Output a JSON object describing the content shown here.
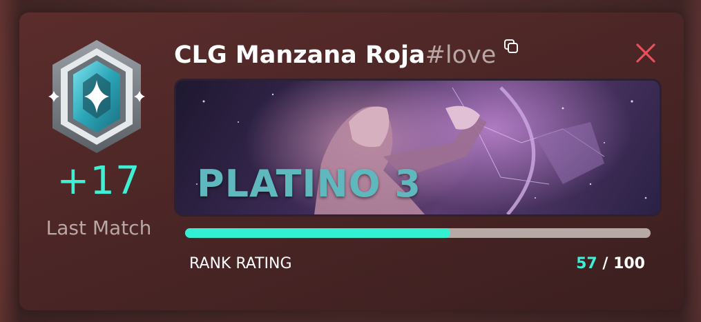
{
  "player": {
    "name": "CLG Manzana Roja",
    "tag": "#love"
  },
  "match": {
    "rr_change": "+17",
    "label": "Last Match"
  },
  "rank": {
    "name": "PLATINO 3"
  },
  "rank_rating": {
    "label": "RANK RATING",
    "current": "57",
    "separator": " / ",
    "max": "100",
    "progress_fraction": 0.57
  },
  "icons": {
    "copy": "copy-icon",
    "close": "close-icon",
    "rank_emblem": "platinum-emblem-icon"
  },
  "colors": {
    "accent": "#3ff0d4",
    "close": "#e8505a",
    "rank_text": "#5fb8be",
    "track": "#b7aaa6"
  }
}
